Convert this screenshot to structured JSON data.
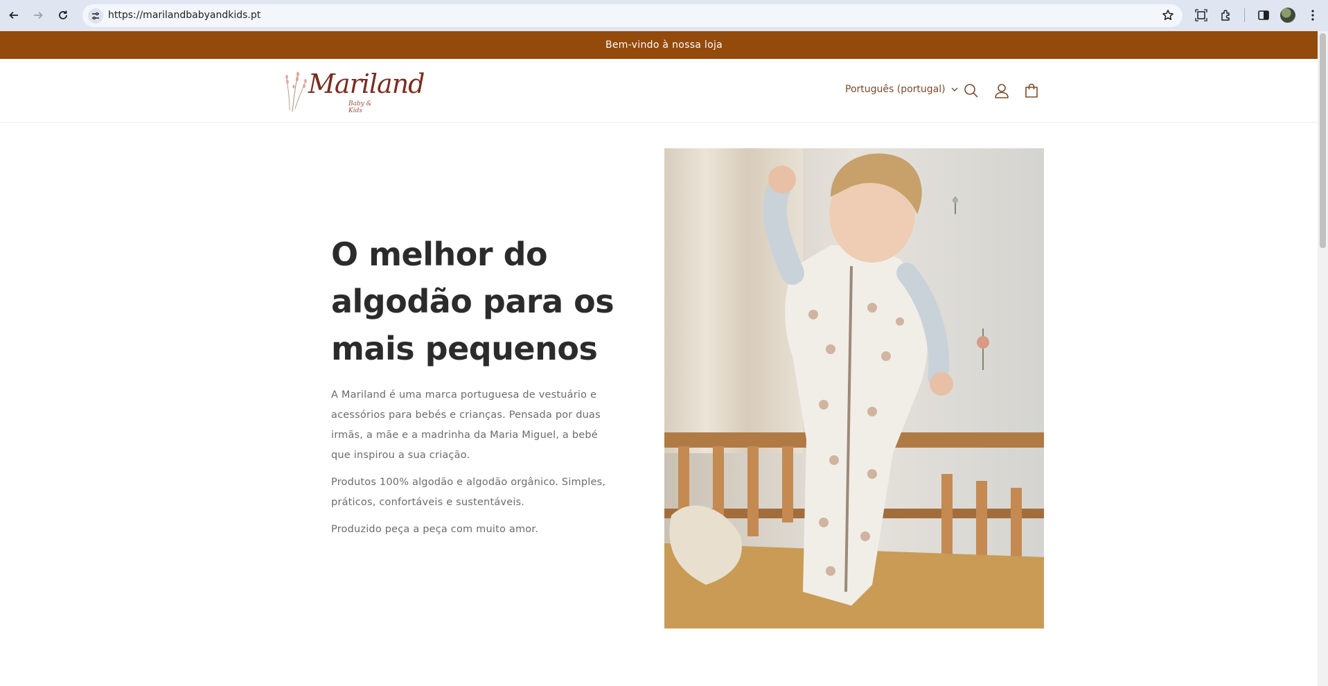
{
  "browser": {
    "url": "https://marilandbabyandkids.pt"
  },
  "announcement": {
    "text": "Bem-vindo à nossa loja"
  },
  "header": {
    "logo_text": "Mariland",
    "logo_subtext": "Baby & Kids",
    "language_selected": "Português (portugal)",
    "icons": [
      "search-icon",
      "account-icon",
      "cart-icon"
    ]
  },
  "hero": {
    "heading": "O melhor do algodão para os mais pequenos",
    "paragraphs": [
      "A Mariland é uma marca portuguesa de vestuário e acessórios para bebés e crianças. Pensada por duas irmãs, a mãe e a madrinha da Maria Miguel, a bebé que inspirou a sua criação.",
      "Produtos 100% algodão e algodão orgânico. Simples, práticos, confortáveis e sustentáveis.",
      "Produzido peça a peça com muito amor."
    ]
  },
  "colors": {
    "announcement_bg": "#944a0b",
    "heading": "#2b2b2b",
    "body_text": "#6b6b6b",
    "accent": "#7a4a2a"
  }
}
